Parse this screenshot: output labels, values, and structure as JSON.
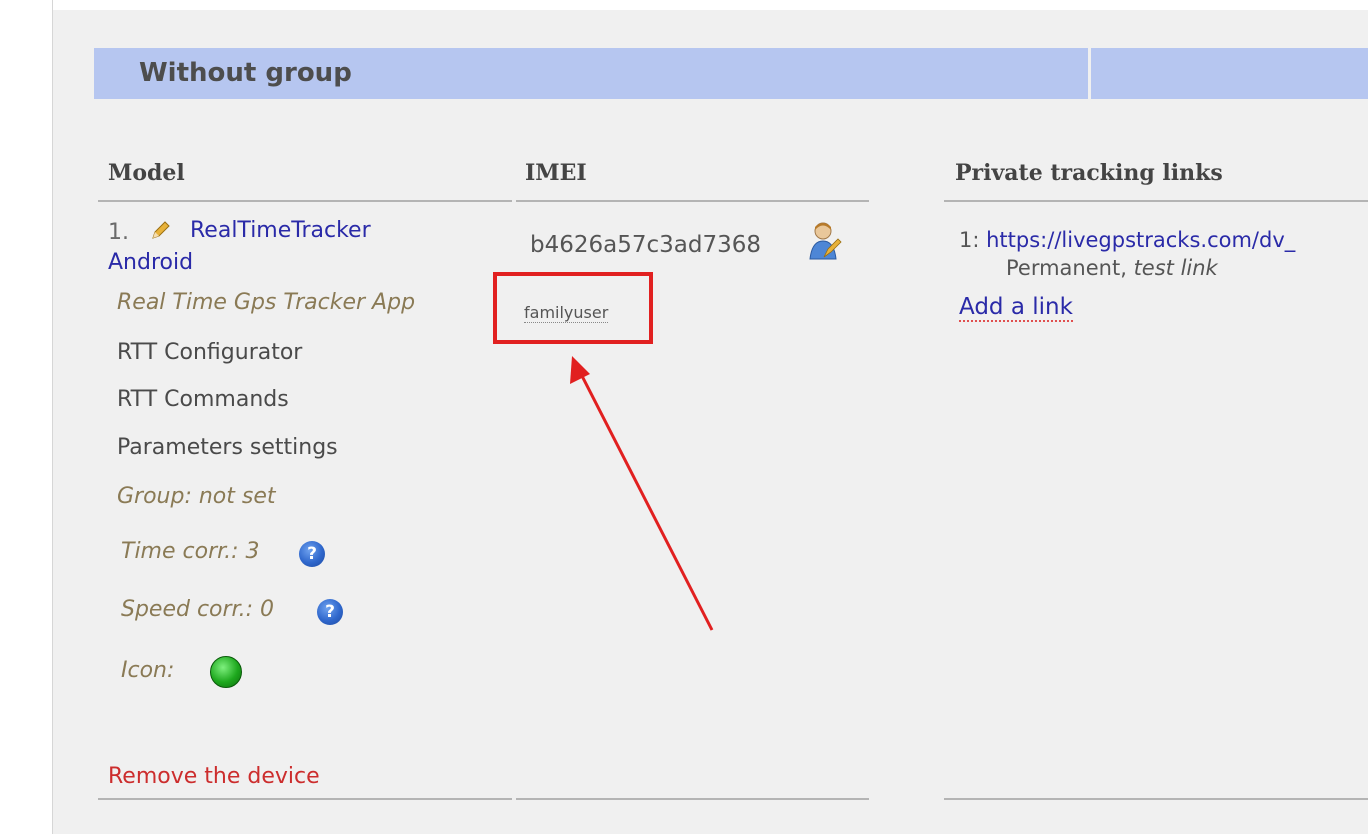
{
  "group": {
    "title": "Without group"
  },
  "columns": {
    "model": "Model",
    "imei": "IMEI",
    "links": "Private tracking links"
  },
  "device": {
    "number": "1.",
    "name_line1": "RealTimeTracker",
    "name_line2": "Android",
    "app": "Real Time Gps Tracker App",
    "menu": [
      "RTT Configurator",
      "RTT Commands",
      "Parameters settings"
    ],
    "group_label": "Group: not set",
    "time_corr": "Time corr.: 3",
    "speed_corr": "Speed corr.: 0",
    "icon_label": "Icon:",
    "imei": "b4626a57c3ad7368",
    "user": "familyuser",
    "remove": "Remove the device"
  },
  "links": {
    "item_index": "1:",
    "item_url": "https://livegpstracks.com/dv_",
    "item_desc": "Permanent,",
    "item_desc_italic": "test link",
    "add": "Add a link"
  },
  "help_glyph": "?",
  "colors": {
    "header": "#b6c6f0",
    "link": "#2a2aa8",
    "danger": "#cc2d2d",
    "annotation": "#e12020"
  }
}
